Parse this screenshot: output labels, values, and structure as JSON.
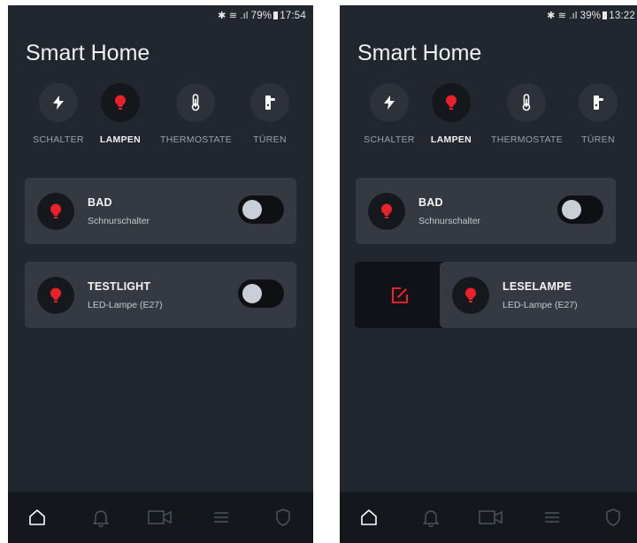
{
  "screens": [
    {
      "status": {
        "battery": "79%",
        "time": "17:54"
      },
      "app_title": "Smart Home",
      "categories": [
        "SCHALTER",
        "LAMPEN",
        "THERMOSTATE",
        "TÜREN"
      ],
      "active_category": "LAMPEN",
      "devices": [
        {
          "name": "BAD",
          "type": "Schnurschalter",
          "on": false
        },
        {
          "name": "TESTLIGHT",
          "type": "LED-Lampe (E27)",
          "on": false
        }
      ]
    },
    {
      "status": {
        "battery": "39%",
        "time": "13:22"
      },
      "app_title": "Smart Home",
      "categories": [
        "SCHALTER",
        "LAMPEN",
        "THERMOSTATE",
        "TÜREN"
      ],
      "active_category": "LAMPEN",
      "devices": [
        {
          "name": "BAD",
          "type": "Schnurschalter",
          "on": false
        },
        {
          "name": "LESELAMPE",
          "type": "LED-Lampe (E27)",
          "swiped": true
        }
      ]
    }
  ],
  "nav_icons": [
    "home-icon",
    "bell-icon",
    "camera-icon",
    "menu-icon",
    "shield-icon"
  ],
  "colors": {
    "accent": "#e8212b",
    "background": "#22262e",
    "card": "#343942",
    "nav": "#14171c"
  }
}
